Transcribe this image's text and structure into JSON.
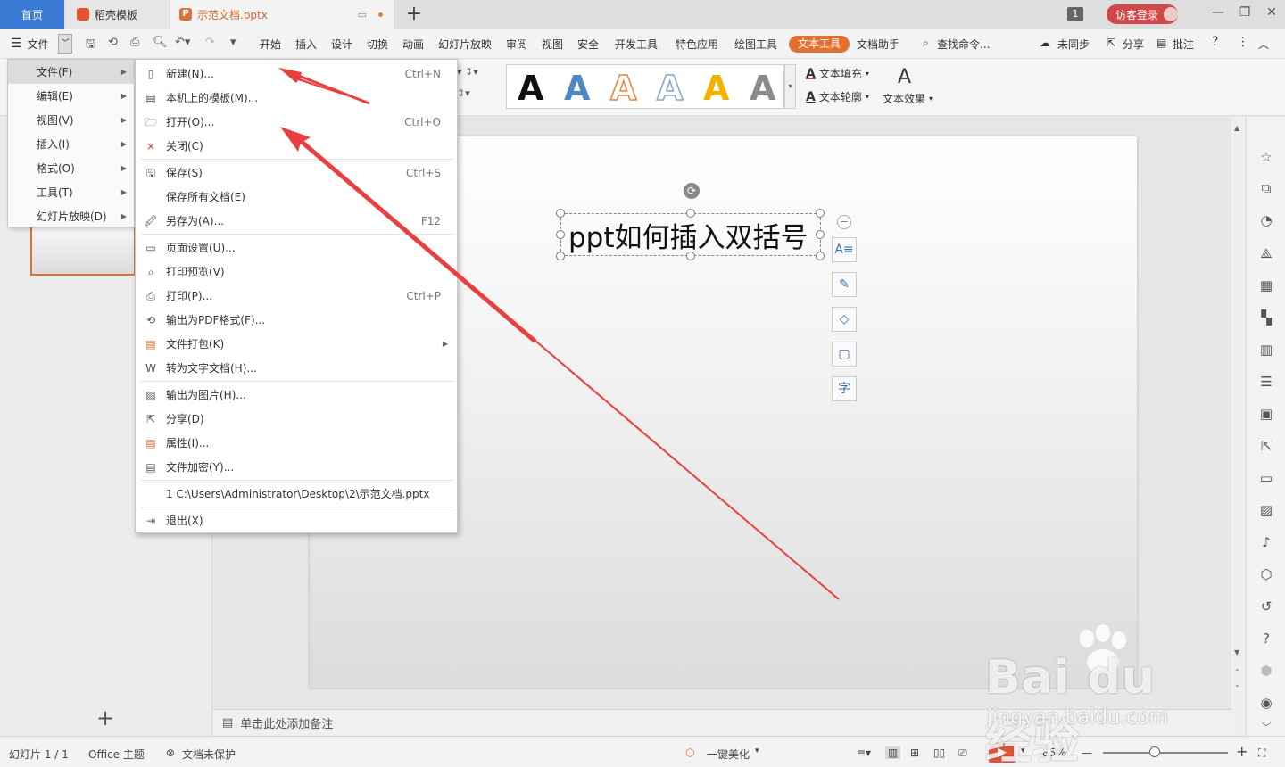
{
  "tabs": {
    "home": "首页",
    "template": "稻壳模板",
    "document": "示范文档.pptx",
    "badge": "1",
    "login": "访客登录"
  },
  "menubar": {
    "file": "文件",
    "items": [
      "开始",
      "插入",
      "设计",
      "切换",
      "动画",
      "幻灯片放映",
      "审阅",
      "视图",
      "安全",
      "开发工具",
      "特色应用",
      "绘图工具",
      "文本工具",
      "文档助手"
    ],
    "active": "文本工具",
    "search": "查找命令...",
    "sync": "未同步",
    "share": "分享",
    "review": "批注"
  },
  "ribbon": {
    "art_letter": "A",
    "text_fill": "文本填充",
    "text_outline": "文本轮廓",
    "text_effect": "文本效果",
    "art_colors": [
      "#111111",
      "#4f86c6",
      "#e8833a",
      "#7fa7d6",
      "#f0b400",
      "#8a8a8a"
    ]
  },
  "slide": {
    "title_text": "ppt如何插入双括号"
  },
  "notes": {
    "placeholder": "单击此处添加备注"
  },
  "status": {
    "slide_count": "幻灯片 1 / 1",
    "theme": "Office 主题",
    "protect": "文档未保护",
    "beautify": "一键美化",
    "zoom": "85%"
  },
  "menu_level1": [
    {
      "label": "文件(F)",
      "highlight": true
    },
    {
      "label": "编辑(E)"
    },
    {
      "label": "视图(V)"
    },
    {
      "label": "插入(I)"
    },
    {
      "label": "格式(O)"
    },
    {
      "label": "工具(T)"
    },
    {
      "label": "幻灯片放映(D)"
    }
  ],
  "menu_file": {
    "new": {
      "label": "新建(N)...",
      "shortcut": "Ctrl+N"
    },
    "local_template": {
      "label": "本机上的模板(M)..."
    },
    "open": {
      "label": "打开(O)...",
      "shortcut": "Ctrl+O"
    },
    "close": {
      "label": "关闭(C)"
    },
    "save": {
      "label": "保存(S)",
      "shortcut": "Ctrl+S"
    },
    "save_all": {
      "label": "保存所有文档(E)"
    },
    "save_as": {
      "label": "另存为(A)...",
      "shortcut": "F12"
    },
    "page_setup": {
      "label": "页面设置(U)..."
    },
    "print_preview": {
      "label": "打印预览(V)"
    },
    "print": {
      "label": "打印(P)...",
      "shortcut": "Ctrl+P"
    },
    "export_pdf": {
      "label": "输出为PDF格式(F)..."
    },
    "package": {
      "label": "文件打包(K)"
    },
    "to_text": {
      "label": "转为文字文档(H)..."
    },
    "export_image": {
      "label": "输出为图片(H)..."
    },
    "share": {
      "label": "分享(D)"
    },
    "properties": {
      "label": "属性(I)..."
    },
    "encrypt": {
      "label": "文件加密(Y)..."
    },
    "recent": {
      "label": "1 C:\\Users\\Administrator\\Desktop\\2\\示范文档.pptx"
    },
    "exit": {
      "label": "退出(X)"
    }
  },
  "watermark": {
    "brand": "Bai du 经验",
    "url": "jingyan.baidu.com"
  }
}
